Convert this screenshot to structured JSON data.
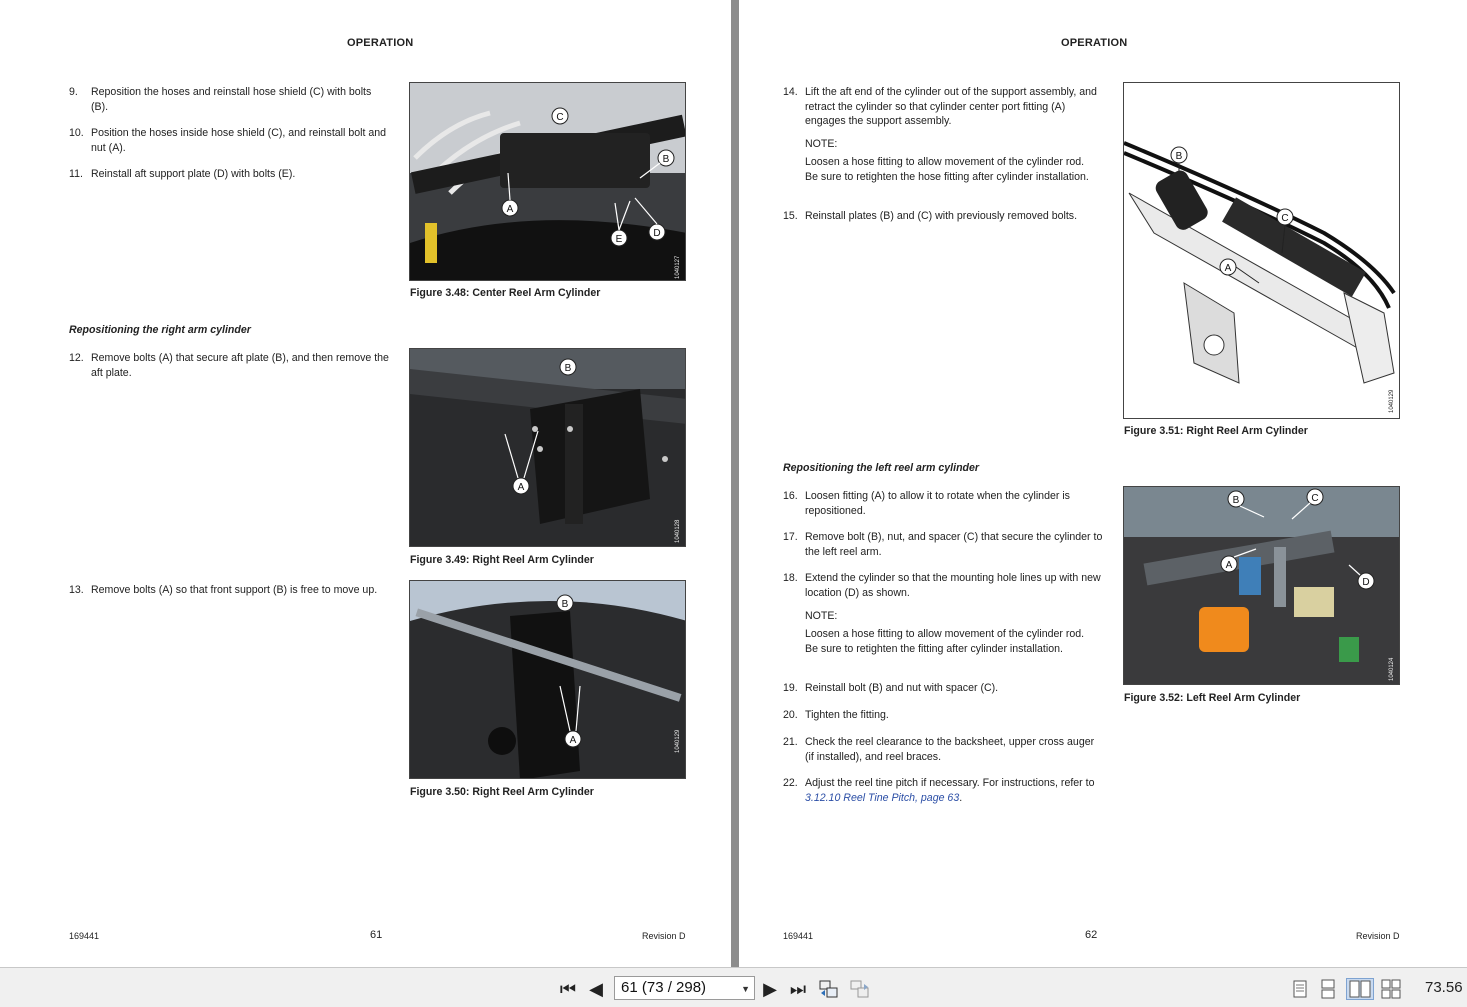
{
  "header": "OPERATION",
  "left_page": {
    "steps_a": [
      {
        "num": "9.",
        "text": "Reposition the hoses and reinstall hose shield (C) with bolts (B)."
      },
      {
        "num": "10.",
        "text": "Position the hoses inside hose shield (C), and reinstall bolt and nut (A)."
      },
      {
        "num": "11.",
        "text": "Reinstall aft support plate (D) with bolts (E)."
      }
    ],
    "subheading": "Repositioning the right arm cylinder",
    "step12": {
      "num": "12.",
      "text": "Remove bolts (A) that secure aft plate (B), and then remove the aft plate."
    },
    "step13": {
      "num": "13.",
      "text": "Remove bolts (A) so that front support (B) is free to move up."
    },
    "figures": [
      {
        "caption": "Figure 3.48: Center Reel Arm Cylinder",
        "code": "1040127",
        "labels": [
          "A",
          "B",
          "C",
          "D",
          "E"
        ]
      },
      {
        "caption": "Figure 3.49: Right Reel Arm Cylinder",
        "code": "1040128",
        "labels": [
          "A",
          "B"
        ]
      },
      {
        "caption": "Figure 3.50: Right Reel Arm Cylinder",
        "code": "1040129",
        "labels": [
          "A",
          "B"
        ]
      }
    ],
    "footer": {
      "doc": "169441",
      "page": "61",
      "rev": "Revision D"
    }
  },
  "right_page": {
    "step14": {
      "num": "14.",
      "text": "Lift the aft end of the cylinder out of the support assembly, and retract the cylinder so that cylinder center port fitting (A) engages the support assembly."
    },
    "note1_head": "NOTE:",
    "note1_body": "Loosen a hose fitting to allow movement of the cylinder rod. Be sure to retighten the hose fitting after cylinder installation.",
    "step15": {
      "num": "15.",
      "text": "Reinstall plates (B) and (C) with previously removed bolts."
    },
    "subheading": "Repositioning the left reel arm cylinder",
    "step16": {
      "num": "16.",
      "text": "Loosen fitting (A) to allow it to rotate when the cylinder is repositioned."
    },
    "step17": {
      "num": "17.",
      "text": "Remove bolt (B), nut, and spacer (C) that secure the cylinder to the left reel arm."
    },
    "step18": {
      "num": "18.",
      "text": "Extend the cylinder so that the mounting hole lines up with new location (D) as shown."
    },
    "note2_head": "NOTE:",
    "note2_body": "Loosen a hose fitting to allow movement of the cylinder rod. Be sure to retighten the fitting after cylinder installation.",
    "step19": {
      "num": "19.",
      "text": "Reinstall bolt (B) and nut with spacer (C)."
    },
    "step20": {
      "num": "20.",
      "text": "Tighten the fitting."
    },
    "step21": {
      "num": "21.",
      "text": "Check the reel clearance to the backsheet, upper cross auger (if installed), and reel braces."
    },
    "step22": {
      "num": "22.",
      "text_pre": "Adjust the reel tine pitch if necessary. For instructions, refer to ",
      "link": "3.12.10 Reel Tine Pitch, page 63",
      "text_post": "."
    },
    "figures": [
      {
        "caption": "Figure 3.51: Right Reel Arm Cylinder",
        "code": "1040129",
        "labels": [
          "A",
          "B",
          "C"
        ]
      },
      {
        "caption": "Figure 3.52: Left Reel Arm Cylinder",
        "code": "1040124",
        "labels": [
          "A",
          "B",
          "C",
          "D"
        ]
      }
    ],
    "footer": {
      "doc": "169441",
      "page": "62",
      "rev": "Revision D"
    }
  },
  "toolbar": {
    "first_label": "⏮",
    "prev_label": "◀",
    "page_value": "61 (73 / 298)",
    "next_label": "▶",
    "last_label": "⏭",
    "zoom_value": "73.56"
  },
  "icons": [
    "first-page-icon",
    "previous-page-icon",
    "next-page-icon",
    "last-page-icon",
    "go-back-view-icon",
    "go-forward-view-icon",
    "single-page-icon",
    "continuous-icon",
    "facing-icon",
    "continuous-facing-icon"
  ]
}
